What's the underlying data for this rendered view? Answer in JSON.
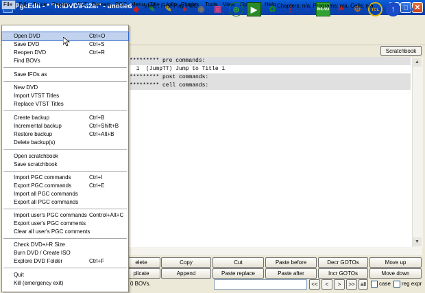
{
  "window": {
    "title": "PgcEdit - * \"H:\\DVD\\Fd2a\\\" - untitled"
  },
  "menubar": [
    "File",
    "Edit",
    "Trace",
    "Preview",
    "DVD",
    "Domain",
    "PGC",
    "Menu",
    "Title",
    "Info",
    "Plugins",
    "Tools",
    "View",
    "Options",
    "Help"
  ],
  "toolbar_icons": [
    "tool-icon-1",
    "tool-icon-2",
    "tool-icon-3",
    "tool-icon-4",
    "disc-icon",
    "tool-icon-6",
    "globe-icon",
    "play-icon",
    "tool-icon-9",
    "tool-icon-10",
    "tool-icon-11",
    "menu-icon",
    "tool-icon-13",
    "tcl-icon",
    "circle-arrow-icon",
    "eye-icon"
  ],
  "toolbar_labels": {
    "menu": "MENU",
    "tcl": "TCL"
  },
  "pgc_bar": {
    "label": "VMG , First-Play PGC",
    "info": "Chapters: n/a,  Programs: n/a,  Cells: n/a",
    "scratchbook": "Scratchbook"
  },
  "editor_lines": [
    "********* pre commands:",
    "  1  (JumpTT) Jump to Title 1",
    "********* post commands:",
    "********* cell commands:"
  ],
  "buttons_row1": [
    "elete",
    "Copy",
    "Cut",
    "Paste before",
    "Decr GOTOs",
    "Move up"
  ],
  "buttons_row2": [
    "plicate",
    "Append",
    "Paste replace",
    "Paste after",
    "Incr GOTOs",
    "Move down"
  ],
  "status": {
    "text": "0 BOVs.",
    "search_value": ""
  },
  "nav": [
    "<<",
    "<",
    ">",
    ">>",
    "all"
  ],
  "options": {
    "case": "case",
    "regexpr": "reg expr"
  },
  "file_menu": {
    "groups": [
      [
        {
          "label": "Open DVD",
          "shortcut": "Ctrl+O"
        },
        {
          "label": "Save DVD",
          "shortcut": "Ctrl+S"
        },
        {
          "label": "Reopen DVD",
          "shortcut": "Ctrl+R"
        },
        {
          "label": "Find BOVs",
          "shortcut": ""
        }
      ],
      [
        {
          "label": "Save IFOs as",
          "shortcut": ""
        }
      ],
      [
        {
          "label": "New DVD",
          "shortcut": ""
        },
        {
          "label": "Import VTST Titles",
          "shortcut": ""
        },
        {
          "label": "Replace VTST Titles",
          "shortcut": ""
        }
      ],
      [
        {
          "label": "Create backup",
          "shortcut": "Ctrl+B"
        },
        {
          "label": "Incremental backup",
          "shortcut": "Ctrl+Shift+B"
        },
        {
          "label": "Restore backup",
          "shortcut": "Ctrl+Alt+B"
        },
        {
          "label": "Delete backup(s)",
          "shortcut": ""
        }
      ],
      [
        {
          "label": "Open scratchbook",
          "shortcut": ""
        },
        {
          "label": "Save scratchbook",
          "shortcut": ""
        }
      ],
      [
        {
          "label": "Import PGC commands",
          "shortcut": "Ctrl+I"
        },
        {
          "label": "Export PGC commands",
          "shortcut": "Ctrl+E"
        },
        {
          "label": "Import all PGC commands",
          "shortcut": ""
        },
        {
          "label": "Export all PGC commands",
          "shortcut": ""
        }
      ],
      [
        {
          "label": "Import user's PGC commands",
          "shortcut": "Control+Alt+C"
        },
        {
          "label": "Export user's PGC comments",
          "shortcut": ""
        },
        {
          "label": "Clear all user's PGC comments",
          "shortcut": ""
        }
      ],
      [
        {
          "label": "Check DVD+/-R Size",
          "shortcut": ""
        },
        {
          "label": "Burn DVD / Create ISO",
          "shortcut": ""
        },
        {
          "label": "Explore DVD Folder",
          "shortcut": "Ctrl+F"
        }
      ],
      [
        {
          "label": "Quit",
          "shortcut": ""
        },
        {
          "label": "Kill (emergency exit)",
          "shortcut": ""
        }
      ]
    ]
  },
  "colors": {
    "titlebar": "#0a5fd8",
    "menu_highlight": "#c1d2ee",
    "editor_highlight": "#e0e0e0"
  }
}
